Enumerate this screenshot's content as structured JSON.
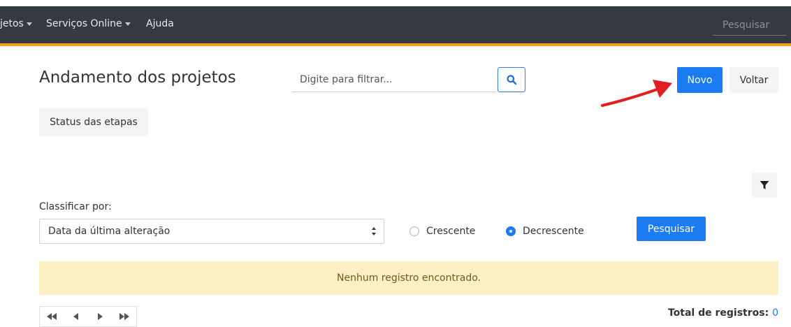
{
  "top_strip": {
    "text": ", ... p   p           ç"
  },
  "nav": {
    "items": [
      {
        "label": "jetos",
        "has_caret": true
      },
      {
        "label": "Serviços Online",
        "has_caret": true
      },
      {
        "label": "Ajuda",
        "has_caret": false
      }
    ],
    "search_placeholder": "Pesquisar"
  },
  "header": {
    "title": "Andamento dos projetos",
    "filter_placeholder": "Digite para filtrar...",
    "novo_label": "Novo",
    "voltar_label": "Voltar"
  },
  "status_button_label": "Status das etapas",
  "sort": {
    "label": "Classificar por:",
    "selected": "Data da última alteração",
    "options": [
      {
        "label": "Crescente",
        "checked": false
      },
      {
        "label": "Decrescente",
        "checked": true
      }
    ],
    "search_button": "Pesquisar"
  },
  "alert_text": "Nenhum registro encontrado.",
  "footer": {
    "total_label": "Total de registros:",
    "total_count": "0"
  },
  "colors": {
    "navbar": "#343a40",
    "accent_underline": "#f0a020",
    "primary": "#1a7bf2",
    "alert_bg": "#fcf0c4",
    "annotation_arrow": "#e02020"
  }
}
